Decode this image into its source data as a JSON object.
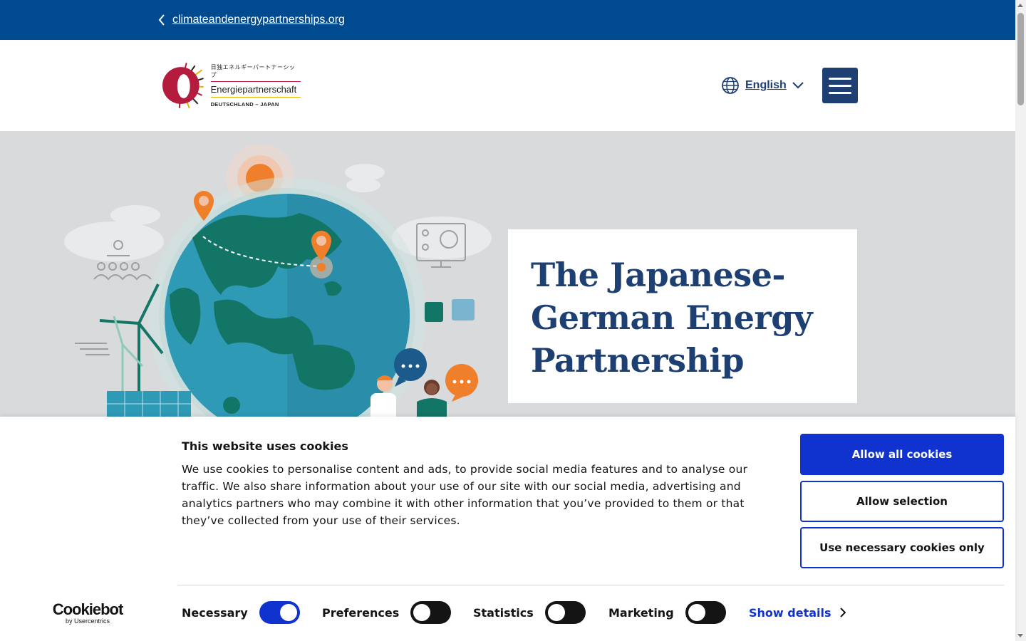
{
  "topbar": {
    "back_link": "climateandenergypartnerships.org",
    "back_icon": "chevron-left-icon"
  },
  "header": {
    "logo": {
      "japanese": "日独エネルギーパートナーシップ",
      "name": "Energiepartnerschaft",
      "subtitle": "DEUTSCHLAND – JAPAN"
    },
    "language": {
      "icon": "globe-icon",
      "label": "English",
      "chevron": "chevron-down-icon"
    },
    "menu_icon": "hamburger-menu-icon"
  },
  "hero": {
    "title": "The Japanese-German Energy Partnership"
  },
  "cookie_banner": {
    "heading": "This website uses cookies",
    "body": "We use cookies to personalise content and ads, to provide social media features and to analyse our traffic. We also share information about your use of our site with our social media, advertising and analytics partners who may combine it with other information that you’ve provided to them or that they’ve collected from your use of their services.",
    "buttons": {
      "allow_all": "Allow all cookies",
      "allow_selection": "Allow selection",
      "necessary_only": "Use necessary cookies only"
    },
    "brand": {
      "name": "Cookiebot",
      "by": "by Usercentrics"
    },
    "toggles": [
      {
        "label": "Necessary",
        "on": true
      },
      {
        "label": "Preferences",
        "on": false
      },
      {
        "label": "Statistics",
        "on": false
      },
      {
        "label": "Marketing",
        "on": false
      }
    ],
    "show_details": "Show details"
  },
  "colors": {
    "topbar": "#004a8f",
    "brand_navy": "#1d3f72",
    "cookie_blue": "#1032cf",
    "hero_bg": "#d8dadc"
  }
}
